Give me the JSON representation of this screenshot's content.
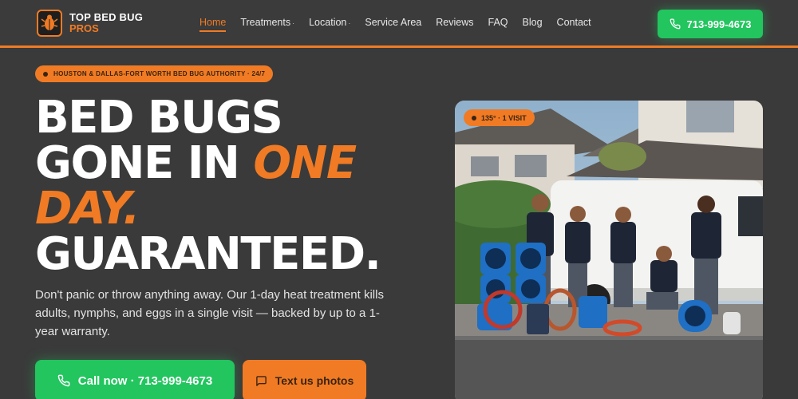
{
  "brand": {
    "line1": "TOP BED BUG",
    "line2": "PROS",
    "icon": "bed-bug-logo-icon",
    "accent": "#f07b24",
    "green": "#22c55e"
  },
  "nav": {
    "items": [
      {
        "label": "Home",
        "active": true
      },
      {
        "label": "Treatments",
        "dropdown": true
      },
      {
        "label": "Location",
        "dropdown": true
      },
      {
        "label": "Service Area"
      },
      {
        "label": "Reviews"
      },
      {
        "label": "FAQ"
      },
      {
        "label": "Blog"
      },
      {
        "label": "Contact"
      }
    ],
    "caret": "·"
  },
  "header_call": {
    "label": "713-999-4673",
    "icon": "phone-icon"
  },
  "hero": {
    "pill": "HOUSTON & DALLAS-FORT WORTH BED BUG AUTHORITY · 24/7",
    "headline": {
      "line1": "BED BUGS",
      "line2_white": "GONE IN ",
      "line2_accent": "ONE",
      "line3_accent": "DAY.",
      "line4": "GUARANTEED."
    },
    "subtext": "Don't panic or throw anything away. Our 1-day heat treatment kills adults, nymphs, and eggs in a single visit — backed by up to a 1-year warranty.",
    "call_button": {
      "label": "Call now · 713-999-4673",
      "icon": "phone-icon"
    },
    "text_button": {
      "label": "Text us photos",
      "icon": "chat-bubble-icon"
    }
  },
  "photo": {
    "badge": "135° · 1 VISIT"
  }
}
